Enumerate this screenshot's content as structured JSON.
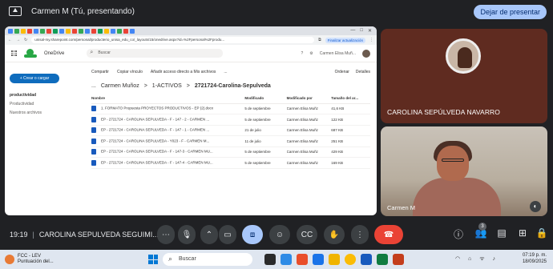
{
  "presenting": {
    "title": "Carmen M (Tú, presentando)",
    "stop_label": "Dejar de presentar"
  },
  "browser": {
    "url": "unisal-my.sharepoint.com/personal/producterio_unisa_edu_co/_layouts/15/onedrive.aspx?id=%2Fpersonal%2Fprodu...",
    "extension_label": "Finalizar actualización"
  },
  "onedrive": {
    "app_name": "OneDrive",
    "search_placeholder": "Buscar",
    "user_name": "Carmen Elisa Muñ...",
    "create_label": "+ Crear o cargar",
    "nav_title": "productividad",
    "nav_items": [
      "Productividad",
      "Nuestros archivos"
    ],
    "commands": [
      "Compartir",
      "Copiar vínculo",
      "Añadir acceso directo a Mis archivos",
      "..."
    ],
    "command_right": [
      "Ordenar",
      "Detalles"
    ],
    "breadcrumb": [
      "...",
      "Carmen Muñoz",
      ">",
      "1-ACTIVOS",
      ">",
      "2721724-Carolina-Sepulveda"
    ],
    "columns": [
      "Nombre",
      "Modificado",
      "Modificado por",
      "Tamaño del ar..."
    ],
    "files": [
      {
        "name": "1. FORMATO Propuesta PROYECTOS PRODUCTIVOS - EP (2).docx",
        "modified": "5 de septiembre",
        "by": "Carmen Elisa Muñz",
        "size": "41,6 KB"
      },
      {
        "name": "EP - 2721724 - CAROLINA SEPULVEDA - F - 147 - 2 - CARMEN ...",
        "modified": "5 de septiembre",
        "by": "Carmen Elisa Muñz",
        "size": "122 KB"
      },
      {
        "name": "EP - 2721724 - CAROLINA SEPULVEDA - F - 147 - 1 - CARMEN ...",
        "modified": "21 de julio",
        "by": "Carmen Elisa Muñz",
        "size": "687 KB"
      },
      {
        "name": "EP - 2721724 - CAROLINA SEPULVEDA - Y023 - F - CARMEN M...",
        "modified": "11 de julio",
        "by": "Carmen Elisa Muñz",
        "size": "251 KB"
      },
      {
        "name": "EP - 2721724 - CAROLINA SEPULVEDA - F - 147-3 - CARMEN MU...",
        "modified": "5 de septiembre",
        "by": "Carmen Elisa Muñz",
        "size": "429 KB"
      },
      {
        "name": "EP - 2721724 - CAROLINA SEPULVEDA - F - 147-4 - CARMEN MU...",
        "modified": "5 de septiembre",
        "by": "Carmen Elisa Muñz",
        "size": "169 KB"
      }
    ]
  },
  "participants": {
    "carolina": "CAROLINA SEPÚLVEDA NAVARRO",
    "carmen": "Carmen M"
  },
  "controls": {
    "time": "19:19",
    "meeting": "CAROLINA SEPULVEDA SEGUIMI...",
    "participant_count": "3"
  },
  "taskbar": {
    "weather_title": "FCC - LEV",
    "weather_sub": "Puntuación del...",
    "search_placeholder": "Buscar",
    "time": "07:19 p. m.",
    "date": "18/09/2025"
  }
}
